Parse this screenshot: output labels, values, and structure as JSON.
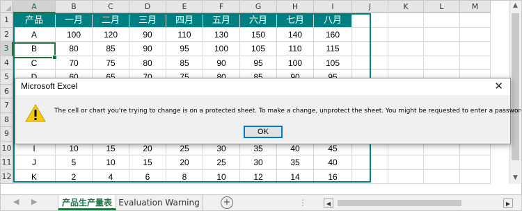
{
  "column_headers": [
    "A",
    "B",
    "C",
    "D",
    "E",
    "F",
    "G",
    "H",
    "I",
    "J",
    "K",
    "L",
    "M"
  ],
  "row_headers": [
    "1",
    "2",
    "3",
    "4",
    "5",
    "6",
    "7",
    "8",
    "9",
    "10",
    "11",
    "12"
  ],
  "selected_cell": "A3",
  "table": {
    "header": [
      "产品",
      "一月",
      "二月",
      "三月",
      "四月",
      "五月",
      "六月",
      "七月",
      "八月"
    ],
    "rows": [
      [
        "A",
        "100",
        "120",
        "90",
        "110",
        "130",
        "150",
        "140",
        "160"
      ],
      [
        "B",
        "80",
        "85",
        "90",
        "95",
        "100",
        "105",
        "110",
        "115"
      ],
      [
        "C",
        "70",
        "75",
        "80",
        "85",
        "90",
        "95",
        "100",
        "105"
      ],
      [
        "D",
        "60",
        "65",
        "70",
        "75",
        "80",
        "85",
        "90",
        "95"
      ],
      [
        "",
        "",
        "",
        "",
        "",
        "",
        "",
        "",
        ""
      ],
      [
        "",
        "",
        "",
        "",
        "",
        "",
        "",
        "",
        ""
      ],
      [
        "",
        "",
        "",
        "",
        "",
        "",
        "",
        "",
        ""
      ],
      [
        "",
        "",
        "",
        "",
        "",
        "",
        "",
        "",
        ""
      ],
      [
        "I",
        "10",
        "15",
        "20",
        "25",
        "30",
        "35",
        "40",
        "45"
      ],
      [
        "J",
        "5",
        "10",
        "15",
        "20",
        "25",
        "30",
        "35",
        "40"
      ],
      [
        "K",
        "2",
        "4",
        "6",
        "8",
        "10",
        "12",
        "14",
        "16"
      ]
    ]
  },
  "dialog": {
    "title": "Microsoft Excel",
    "message": "The cell or chart you're trying to change is on a protected sheet. To make a change, unprotect the sheet. You might be requested to enter a password.",
    "ok_label": "OK",
    "close_glyph": "✕"
  },
  "sheet_tabs": [
    {
      "label": "产品生产量表",
      "active": true
    },
    {
      "label": "Evaluation Warning",
      "active": false
    }
  ],
  "add_sheet_glyph": "+",
  "colors": {
    "header_fill": "#008080",
    "header_text": "#ffffff",
    "selection": "#217346",
    "dialog_button_border": "#0078d7",
    "warning_icon": "#f2c811"
  }
}
